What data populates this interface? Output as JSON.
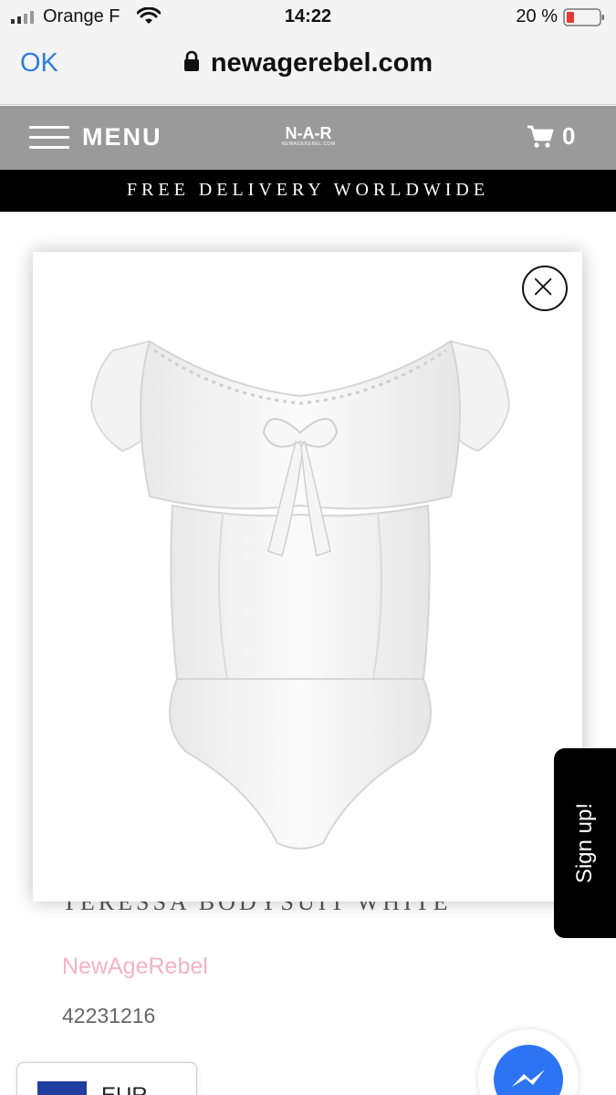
{
  "status_bar": {
    "carrier": "Orange F",
    "time": "14:22",
    "battery": "20 %"
  },
  "browser": {
    "ok_label": "OK",
    "url": "newagerebel.com"
  },
  "header": {
    "menu_label": "MENU",
    "logo_text": "N-A-R",
    "logo_subtext": "NEWAGEREBEL.COM",
    "cart_count": "0"
  },
  "promo": {
    "text": "FREE DELIVERY WORLDWIDE"
  },
  "product": {
    "title": "TERESSA BODYSUIT WHITE",
    "brand": "NewAgeRebel",
    "sku": "42231216"
  },
  "signup": {
    "label": "Sign up!"
  },
  "currency": {
    "code": "EUR"
  },
  "colors": {
    "header_bg": "#9a9a9a",
    "promo_bg": "#000000",
    "brand_pink": "#f2b3c4",
    "ios_blue": "#2f7ce0",
    "messenger_blue": "#2d74f4",
    "battery_red": "#e53935"
  },
  "icons": {
    "close": "close-icon",
    "cart": "cart-icon",
    "lock": "lock-icon",
    "menu": "hamburger-icon",
    "messenger": "messenger-icon"
  }
}
